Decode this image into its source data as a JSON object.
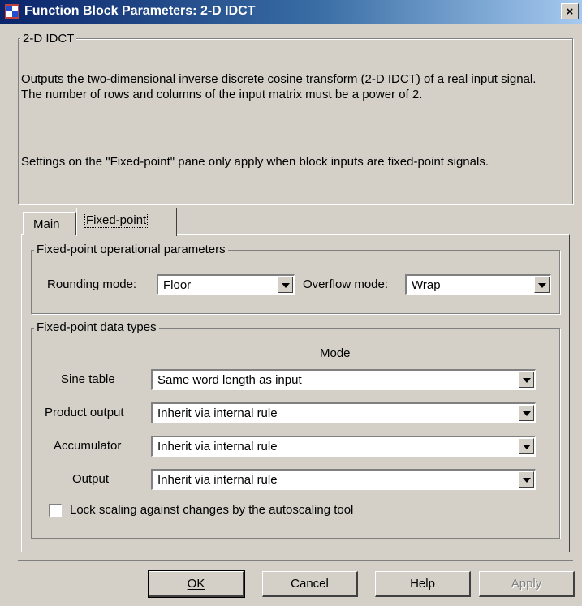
{
  "window": {
    "title": "Function Block Parameters: 2-D IDCT",
    "close_label": "×"
  },
  "block": {
    "group_title": "2-D IDCT",
    "description_1": "Outputs the two-dimensional inverse discrete cosine transform (2-D IDCT) of a real input signal. The number of rows and columns of the input matrix must be a power of 2.",
    "description_2": "Settings on the \"Fixed-point\" pane only apply when block inputs are fixed-point signals."
  },
  "tabs": [
    {
      "label": "Main",
      "selected": false
    },
    {
      "label": "Fixed-point",
      "selected": true
    }
  ],
  "operational": {
    "group_title": "Fixed-point operational parameters",
    "rounding_label": "Rounding mode:",
    "rounding_value": "Floor",
    "overflow_label": "Overflow mode:",
    "overflow_value": "Wrap"
  },
  "datatypes": {
    "group_title": "Fixed-point data types",
    "mode_header": "Mode",
    "rows": [
      {
        "label": "Sine table",
        "value": "Same word length as input"
      },
      {
        "label": "Product output",
        "value": "Inherit via internal rule"
      },
      {
        "label": "Accumulator",
        "value": "Inherit via internal rule"
      },
      {
        "label": "Output",
        "value": "Inherit via internal rule"
      }
    ],
    "lock_scaling_label": "Lock scaling against changes by the autoscaling tool",
    "lock_scaling_checked": false
  },
  "buttons": {
    "ok": "OK",
    "cancel": "Cancel",
    "help": "Help",
    "apply": "Apply",
    "apply_enabled": false
  },
  "colors": {
    "face": "#d4d0c8",
    "title_start": "#0a246a",
    "title_end": "#a6caf0"
  }
}
